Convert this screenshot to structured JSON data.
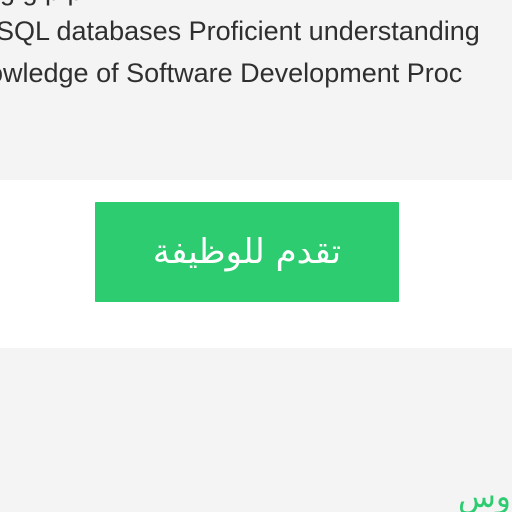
{
  "job_description": {
    "lines": [
      "g                 g  p      p",
      "SQL databases Proficient understanding",
      "owledge of Software Development Proc"
    ]
  },
  "apply": {
    "button_label": "تقدم للوظيفة",
    "accent_color": "#2ecc71"
  },
  "footer": {
    "link_fragment": "وس"
  }
}
